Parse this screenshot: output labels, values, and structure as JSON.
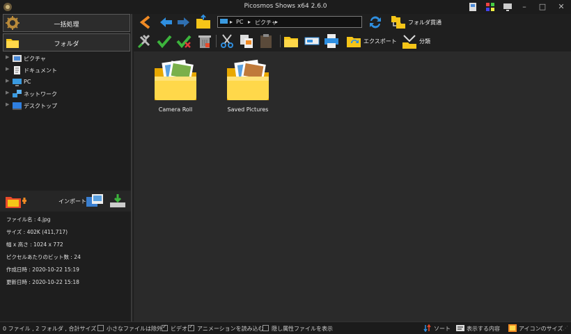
{
  "window": {
    "title": "Picosmos Shows x64 2.6.0"
  },
  "left_panel": {
    "batch_button": "一括処理",
    "folder_button": "フォルダ",
    "tree": [
      {
        "label": "ピクチャ",
        "icon": "pictures-icon"
      },
      {
        "label": "ドキュメント",
        "icon": "documents-icon"
      },
      {
        "label": "PC",
        "icon": "pc-icon"
      },
      {
        "label": "ネットワーク",
        "icon": "network-icon"
      },
      {
        "label": "デスクトップ",
        "icon": "desktop-icon"
      }
    ],
    "import_label": "インポート",
    "file_info": {
      "filename": "ファイル名 : 4.jpg",
      "size": "サイズ : 402K (411,717)",
      "dimensions": "幅 x 高さ : 1024 x 772",
      "bit_depth": "ピクセルあたりのビット数 : 24",
      "created": "作成日時 : 2020-10-22 15:19",
      "modified": "更新日時 : 2020-10-22 15:18"
    }
  },
  "navbar": {
    "address": [
      "PC",
      "ピクチャ"
    ],
    "folder_traverse": "フォルダ貫通"
  },
  "toolbar": {
    "export_label": "エクスポート",
    "classify_label": "分類"
  },
  "content": {
    "folders": [
      {
        "name": "Camera Roll"
      },
      {
        "name": "Saved Pictures"
      }
    ]
  },
  "status_bar": {
    "summary": "0 ファイル , 2 フォルダ , 合計サイズ 0",
    "exclude_small": "小さなファイルは除外",
    "video": "ビデオ",
    "load_animation": "アニメーションを読み込む",
    "show_hidden": "隠し属性ファイルを表示",
    "sort": "ソート",
    "display_content": "表示する内容",
    "icon_size": "アイコンのサイズ"
  },
  "colors": {
    "folder_yellow": "#f5c518",
    "accent_blue": "#2f8fe0",
    "accent_orange": "#f08a24",
    "check_green": "#3cb43c"
  }
}
